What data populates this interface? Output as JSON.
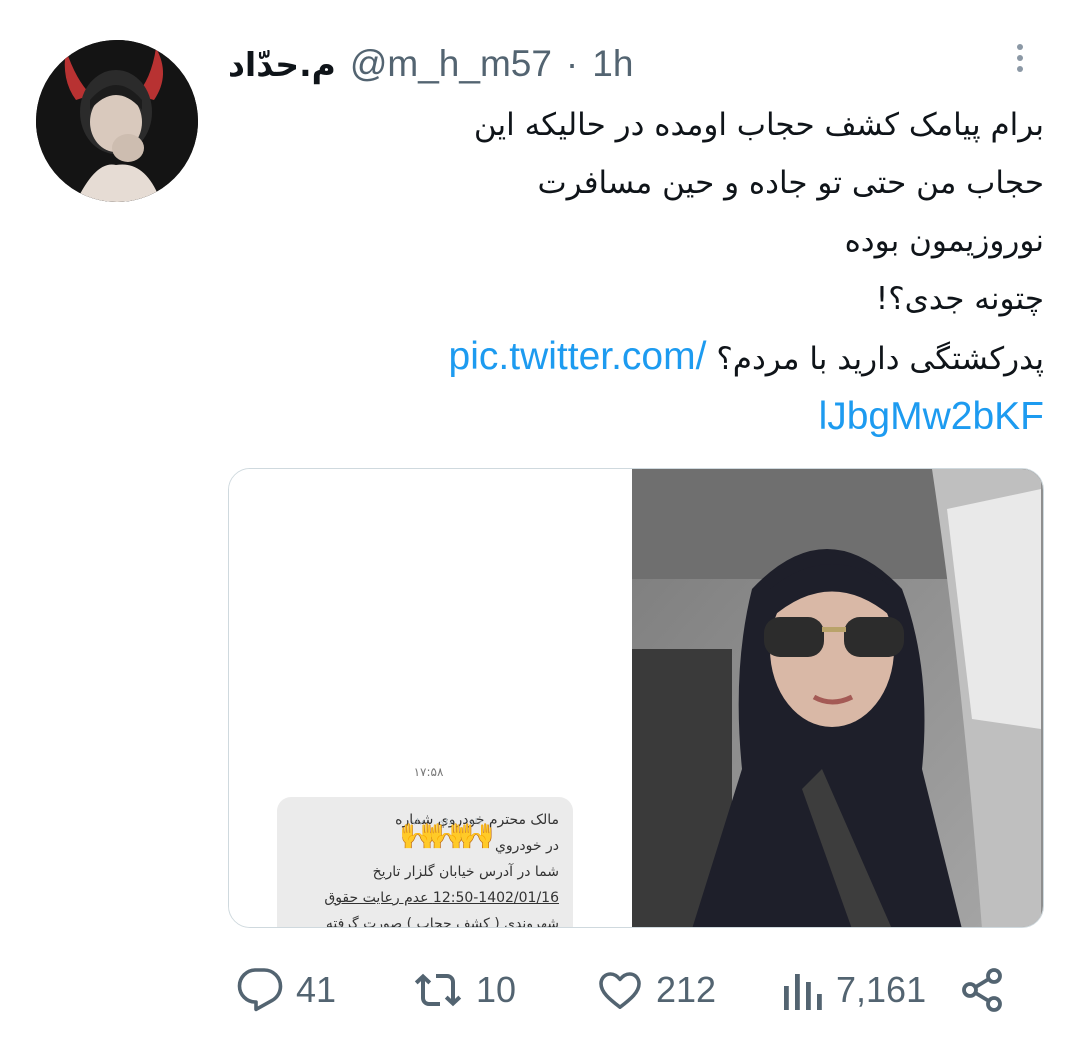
{
  "author": {
    "display_name": "م.حدّاد",
    "handle": "@m_h_m57",
    "separator": "·",
    "time": "1h"
  },
  "tweet": {
    "lines": [
      "برام پیامک کشف حجاب اومده در حالیکه این",
      "حجاب من حتی تو جاده و حین مسافرت",
      "نوروزیمون بوده",
      "چتونه جدی؟!",
      "پدرکشتگی دارید با مردم؟"
    ],
    "link_part1": "pic.twitter.com/",
    "link_part2": "lJbgMw2bKF"
  },
  "media": {
    "sms_time": "۱۷:۵۸",
    "sms_lines": [
      "مالک محترم خودروي شماره",
      "در خودروي",
      "شما در آدرس خيابان گلزار تاريخ",
      "12:50-1402/01/16 عدم رعايت حقوق",
      "شهروندي ( كشف حجاب ) صورت گرفته"
    ],
    "hands_emoji": "🙌🙌🙌"
  },
  "actions": {
    "replies": "41",
    "retweets": "10",
    "likes": "212",
    "views": "7,161"
  },
  "icons": {
    "reply": "reply-icon",
    "retweet": "retweet-icon",
    "like": "heart-icon",
    "views": "views-icon",
    "share": "share-icon",
    "more": "more-icon"
  },
  "colors": {
    "link": "#1d9bf0",
    "secondary_text": "#536471",
    "primary_text": "#0f1419"
  }
}
